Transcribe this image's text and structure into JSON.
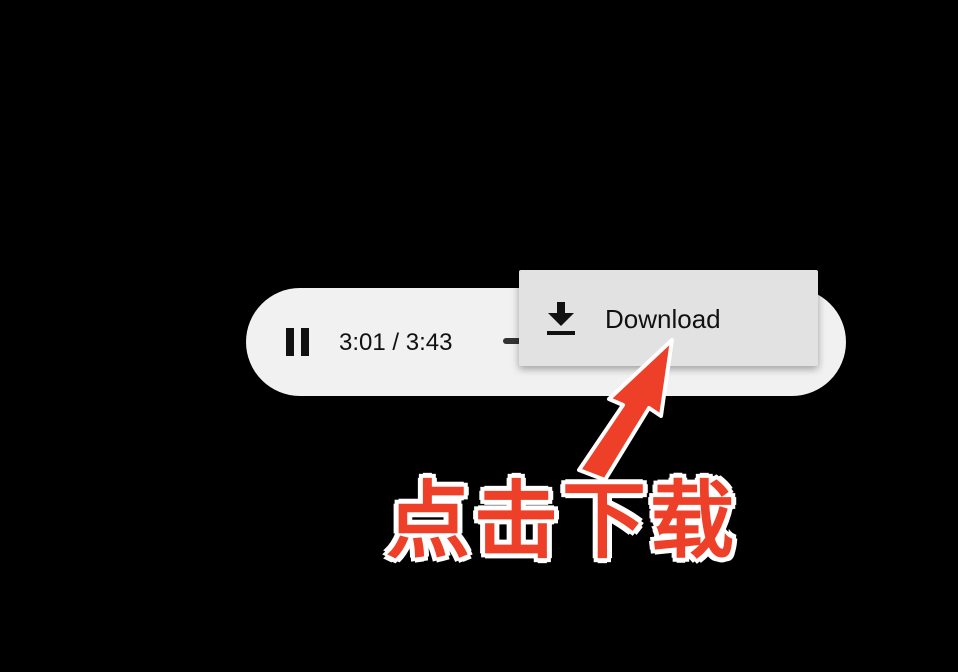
{
  "player": {
    "time_display": "3:01 / 3:43",
    "pause_icon": "pause-icon",
    "progress_fraction": 0.81
  },
  "menu": {
    "items": [
      {
        "label": "Download",
        "icon": "download-icon"
      }
    ]
  },
  "annotation": {
    "text": "点击下载",
    "color": "#ee3f28"
  },
  "colors": {
    "background": "#000000",
    "player_bg": "#f1f1f1",
    "menu_bg": "#e2e2e2"
  }
}
